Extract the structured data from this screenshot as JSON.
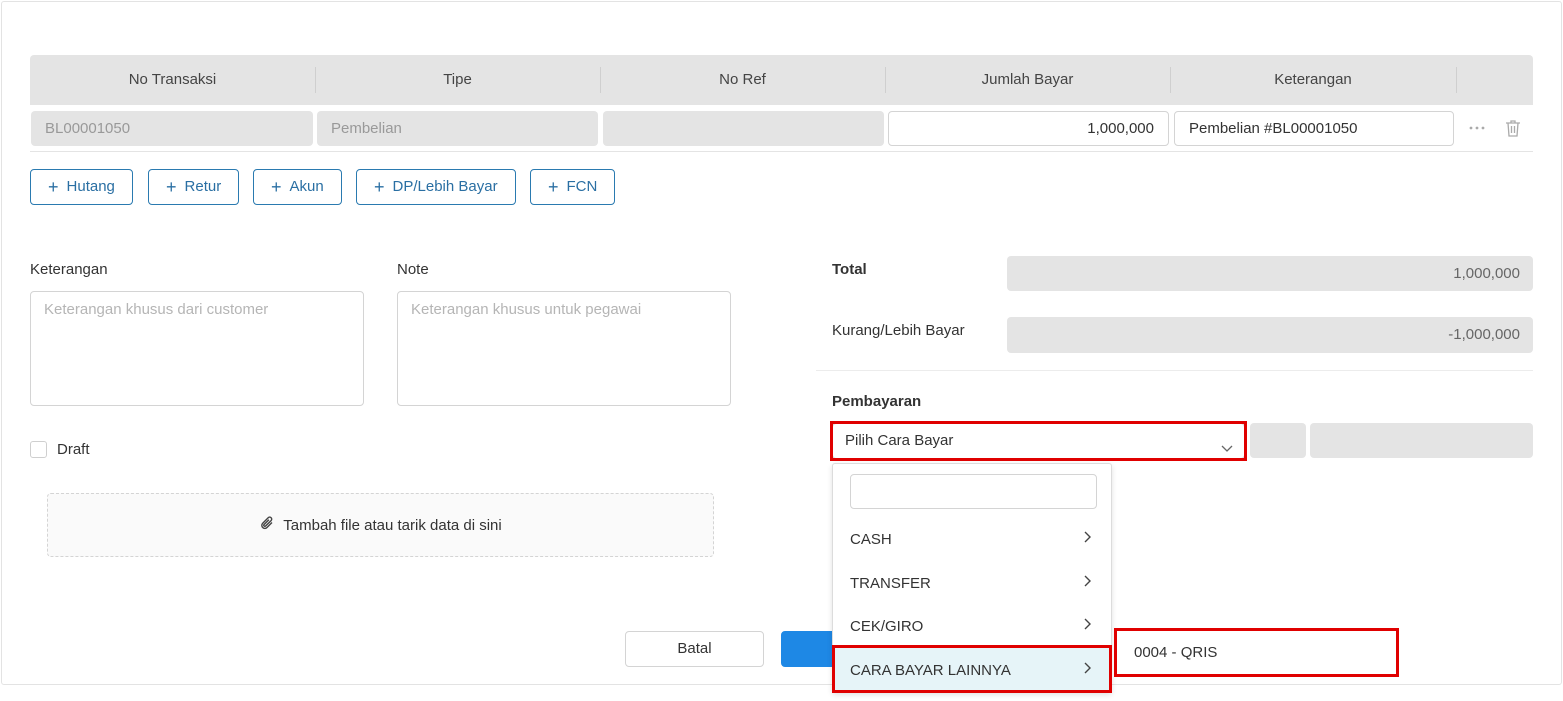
{
  "table": {
    "headers": [
      "No Transaksi",
      "Tipe",
      "No Ref",
      "Jumlah Bayar",
      "Keterangan"
    ],
    "row": {
      "no_transaksi": "BL00001050",
      "tipe": "Pembelian",
      "no_ref": "",
      "jumlah_bayar": "1,000,000",
      "keterangan": "Pembelian #BL00001050"
    }
  },
  "add_buttons": [
    "Hutang",
    "Retur",
    "Akun",
    "DP/Lebih Bayar",
    "FCN"
  ],
  "form": {
    "keterangan_label": "Keterangan",
    "keterangan_placeholder": "Keterangan khusus dari customer",
    "note_label": "Note",
    "note_placeholder": "Keterangan khusus untuk pegawai",
    "draft_label": "Draft",
    "upload_label": "Tambah file atau tarik data di sini"
  },
  "summary": {
    "total_label": "Total",
    "total_value": "1,000,000",
    "kurang_label": "Kurang/Lebih Bayar",
    "kurang_value": "-1,000,000"
  },
  "payment": {
    "title": "Pembayaran",
    "select_placeholder": "Pilih Cara Bayar",
    "options": [
      "CASH",
      "TRANSFER",
      "CEK/GIRO",
      "CARA BAYAR LAINNYA"
    ],
    "active_option": "CARA BAYAR LAINNYA",
    "submenu_item": "0004 - QRIS"
  },
  "footer": {
    "cancel_label": "Batal"
  },
  "colors": {
    "accent": "#2a7ab0",
    "primary": "#1e88e5",
    "highlight": "#e00000"
  }
}
